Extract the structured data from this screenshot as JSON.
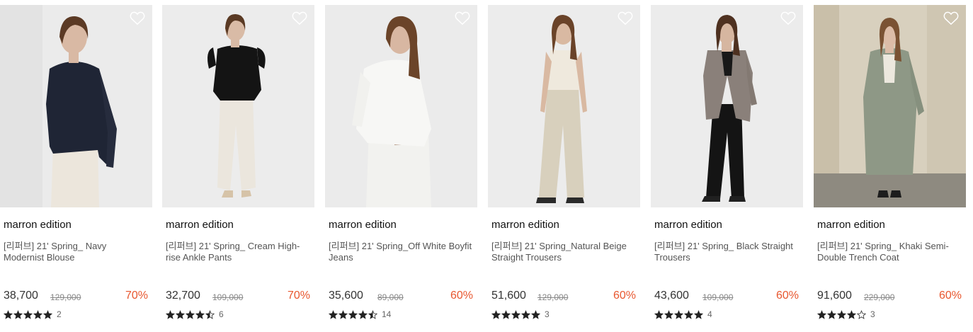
{
  "colors": {
    "discount": "#e8572f",
    "star": "#222222",
    "heart": "#ffffff"
  },
  "products": [
    {
      "brand": "marron edition",
      "name": "[리퍼브] 21' Spring_ Navy Modernist Blouse",
      "price": "38,700",
      "original_price": "129,000",
      "discount": "70%",
      "rating": 5,
      "review_count": "2",
      "icon": "heart-outline-icon"
    },
    {
      "brand": "marron edition",
      "name": "[리퍼브] 21' Spring_ Cream High-rise Ankle Pants",
      "price": "32,700",
      "original_price": "109,000",
      "discount": "70%",
      "rating": 4.5,
      "review_count": "6",
      "icon": "heart-outline-icon"
    },
    {
      "brand": "marron edition",
      "name": "[리퍼브] 21' Spring_Off White Boyfit Jeans",
      "price": "35,600",
      "original_price": "89,000",
      "discount": "60%",
      "rating": 4.5,
      "review_count": "14",
      "icon": "heart-outline-icon"
    },
    {
      "brand": "marron edition",
      "name": "[리퍼브] 21' Spring_Natural Beige Straight Trousers",
      "price": "51,600",
      "original_price": "129,000",
      "discount": "60%",
      "rating": 5,
      "review_count": "3",
      "icon": "heart-outline-icon"
    },
    {
      "brand": "marron edition",
      "name": "[리퍼브] 21' Spring_ Black Straight Trousers",
      "price": "43,600",
      "original_price": "109,000",
      "discount": "60%",
      "rating": 5,
      "review_count": "4",
      "icon": "heart-outline-icon"
    },
    {
      "brand": "marron edition",
      "name": "[리퍼브] 21' Spring_ Khaki Semi-Double Trench Coat",
      "price": "91,600",
      "original_price": "229,000",
      "discount": "60%",
      "rating": 4,
      "review_count": "3",
      "icon": "heart-outline-icon"
    }
  ]
}
